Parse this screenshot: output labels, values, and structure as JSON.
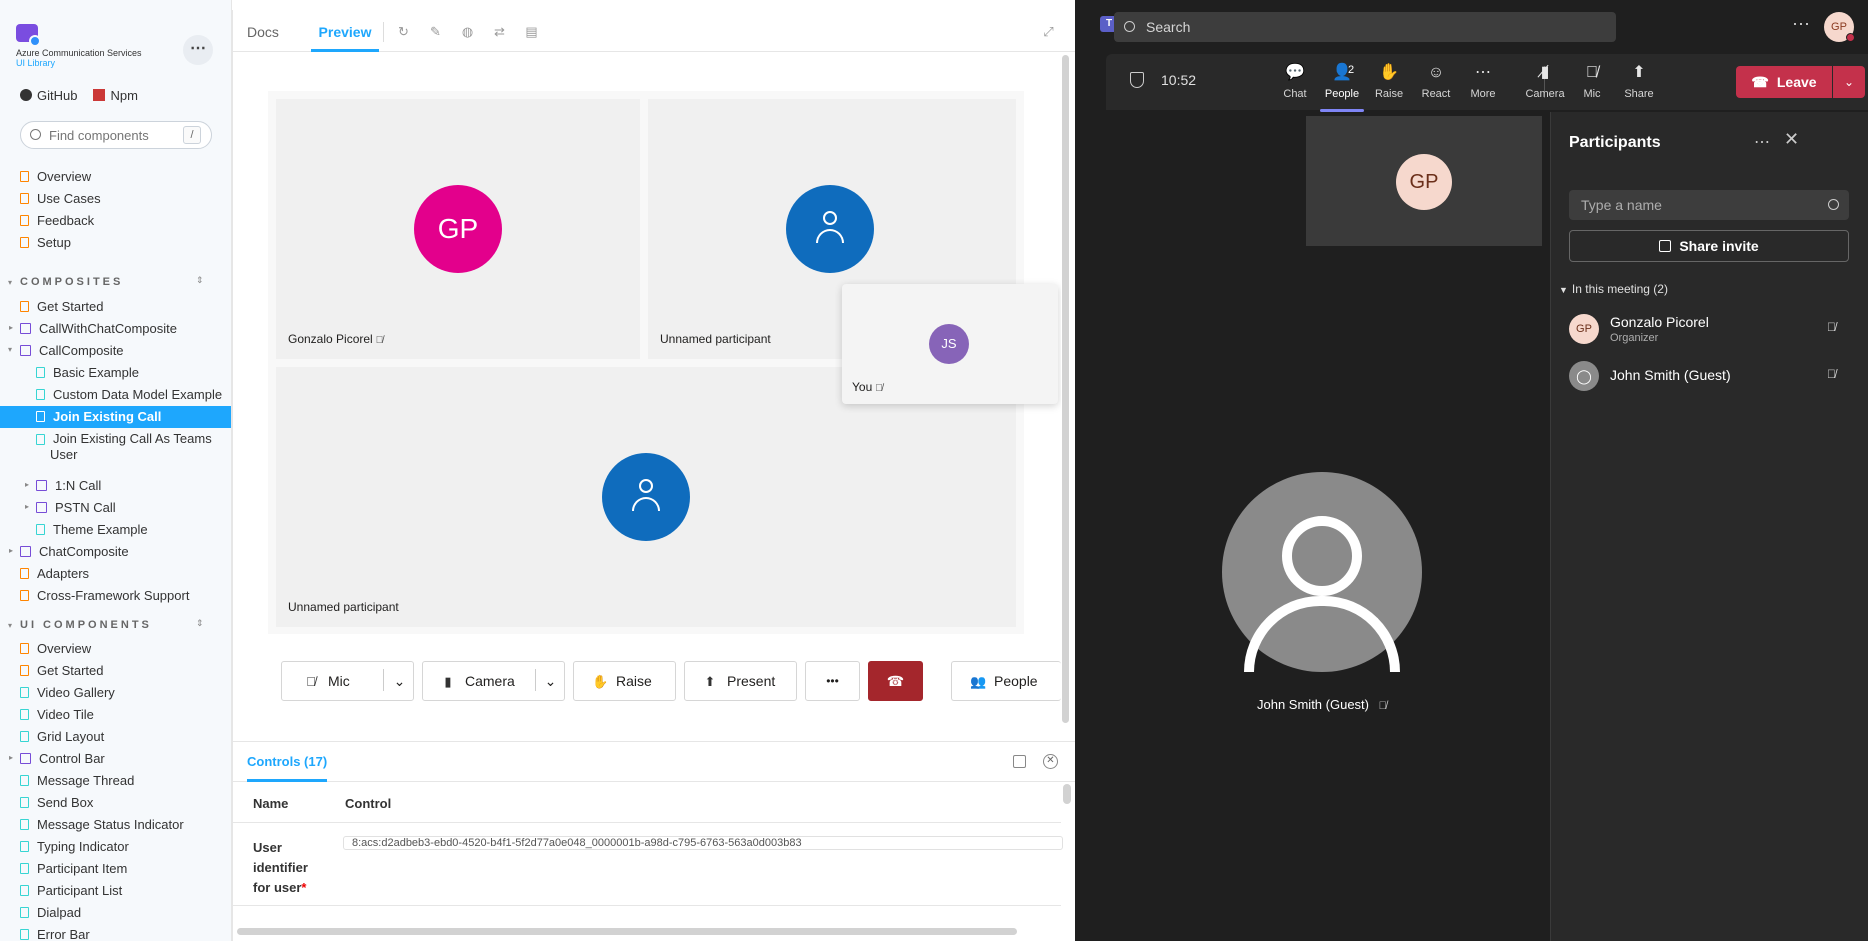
{
  "storybook": {
    "brand": {
      "line1": "Azure Communication Services",
      "line2": "UI Library"
    },
    "links": [
      {
        "label": "GitHub"
      },
      {
        "label": "Npm"
      }
    ],
    "search": {
      "placeholder": "Find components",
      "shortcut": "/"
    },
    "top_items": [
      "Overview",
      "Use Cases",
      "Feedback",
      "Setup"
    ],
    "sections": [
      {
        "title": "COMPOSITES"
      },
      {
        "title": "UI COMPONENTS"
      }
    ],
    "composites": {
      "get_started": "Get Started",
      "call_with_chat": "CallWithChatComposite",
      "call_composite": "CallComposite",
      "children": [
        "Basic Example",
        "Custom Data Model Example",
        "Join Existing Call",
        "Join Existing Call As Teams User",
        "1:N Call",
        "PSTN Call",
        "Theme Example"
      ],
      "chat_composite": "ChatComposite",
      "adapters": "Adapters",
      "cross_framework": "Cross-Framework Support"
    },
    "ui_components": [
      "Overview",
      "Get Started",
      "Video Gallery",
      "Video Tile",
      "Grid Layout",
      "Control Bar",
      "Message Thread",
      "Send Box",
      "Message Status Indicator",
      "Typing Indicator",
      "Participant Item",
      "Participant List",
      "Dialpad",
      "Error Bar"
    ],
    "tabs": [
      "Docs",
      "Preview"
    ],
    "gallery": {
      "tiles": [
        {
          "initials": "GP",
          "name": "Gonzalo Picorel"
        },
        {
          "initials": "",
          "name": "Unnamed participant"
        },
        {
          "initials": "",
          "name": "Unnamed participant"
        }
      ],
      "local": {
        "initials": "JS",
        "name": "You"
      }
    },
    "control_bar": {
      "mic": "Mic",
      "camera": "Camera",
      "raise": "Raise",
      "present": "Present",
      "more": "•••",
      "people": "People"
    },
    "controls": {
      "tab": "Controls (17)",
      "headers": {
        "name": "Name",
        "control": "Control"
      },
      "rows": [
        {
          "name": "User identifier for user",
          "value": "8:acs:d2adbeb3-ebd0-4520-b4f1-5f2d77a0e048_0000001b-a98d-c795-6763-563a0d003b83"
        }
      ]
    }
  },
  "teams": {
    "search": "Search",
    "me_initials": "GP",
    "time": "10:52",
    "actions": [
      {
        "label": "Chat",
        "icon": "chat-icon"
      },
      {
        "label": "People",
        "icon": "people-icon",
        "badge": "2"
      },
      {
        "label": "Raise",
        "icon": "hand-icon"
      },
      {
        "label": "React",
        "icon": "smile-icon"
      },
      {
        "label": "More",
        "icon": "more-icon"
      },
      {
        "label": "Camera",
        "icon": "camera-off-icon"
      },
      {
        "label": "Mic",
        "icon": "mic-off-icon"
      },
      {
        "label": "Share",
        "icon": "share-icon"
      }
    ],
    "leave": "Leave",
    "stage": {
      "mini_initials": "GP",
      "main_name": "John Smith (Guest)"
    },
    "panel": {
      "title": "Participants",
      "placeholder": "Type a name",
      "share_invite": "Share invite",
      "section": "In this meeting (2)",
      "participants": [
        {
          "initials": "GP",
          "name": "Gonzalo Picorel",
          "role": "Organizer"
        },
        {
          "initials": "",
          "name": "John Smith (Guest)",
          "role": ""
        }
      ]
    }
  }
}
